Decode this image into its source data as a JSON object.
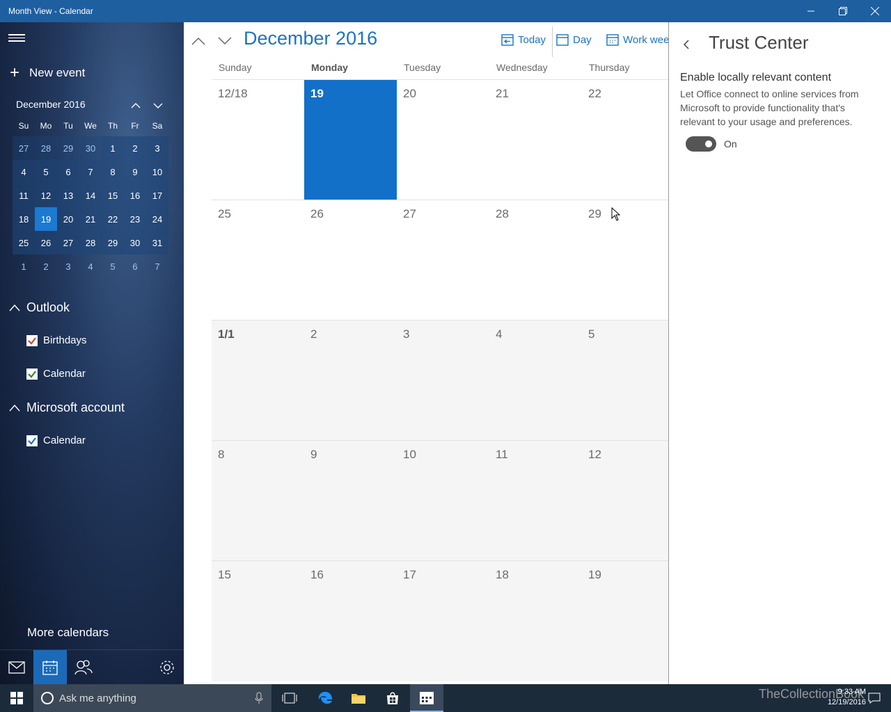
{
  "window": {
    "title": "Month View - Calendar"
  },
  "sidebar": {
    "new_event": "New event",
    "mini_month": "December 2016",
    "dow": [
      "Su",
      "Mo",
      "Tu",
      "We",
      "Th",
      "Fr",
      "Sa"
    ],
    "weeks": [
      [
        "27",
        "28",
        "29",
        "30",
        "1",
        "2",
        "3"
      ],
      [
        "4",
        "5",
        "6",
        "7",
        "8",
        "9",
        "10"
      ],
      [
        "11",
        "12",
        "13",
        "14",
        "15",
        "16",
        "17"
      ],
      [
        "18",
        "19",
        "20",
        "21",
        "22",
        "23",
        "24"
      ],
      [
        "25",
        "26",
        "27",
        "28",
        "29",
        "30",
        "31"
      ],
      [
        "1",
        "2",
        "3",
        "4",
        "5",
        "6",
        "7"
      ]
    ],
    "groups": [
      {
        "name": "Outlook",
        "items": [
          {
            "label": "Birthdays",
            "color": "#d3452b"
          },
          {
            "label": "Calendar",
            "color": "#2e8b2e"
          }
        ]
      },
      {
        "name": "Microsoft account",
        "items": [
          {
            "label": "Calendar",
            "color": "#1b73c5"
          }
        ]
      }
    ],
    "more_calendars": "More calendars"
  },
  "main": {
    "month_title": "December 2016",
    "view_buttons": [
      "Today",
      "Day",
      "Work week"
    ],
    "dow": [
      "Sunday",
      "Monday",
      "Tuesday",
      "Wednesday",
      "Thursday"
    ],
    "weeks": [
      [
        "12/18",
        "19",
        "20",
        "21",
        "22"
      ],
      [
        "25",
        "26",
        "27",
        "28",
        "29"
      ],
      [
        "1/1",
        "2",
        "3",
        "4",
        "5"
      ],
      [
        "8",
        "9",
        "10",
        "11",
        "12"
      ],
      [
        "15",
        "16",
        "17",
        "18",
        "19"
      ]
    ]
  },
  "trust_center": {
    "title": "Trust Center",
    "subtitle": "Enable locally relevant content",
    "description": "Let Office connect to online services from Microsoft to provide functionality that's relevant to your usage and preferences.",
    "toggle_state": "On"
  },
  "taskbar": {
    "search_placeholder": "Ask me anything",
    "time": "9:33 AM",
    "date": "12/19/2016",
    "watermark": "TheCollectionBook"
  },
  "colors": {
    "accent": "#1270c9",
    "titlebar": "#1e5fa0"
  }
}
